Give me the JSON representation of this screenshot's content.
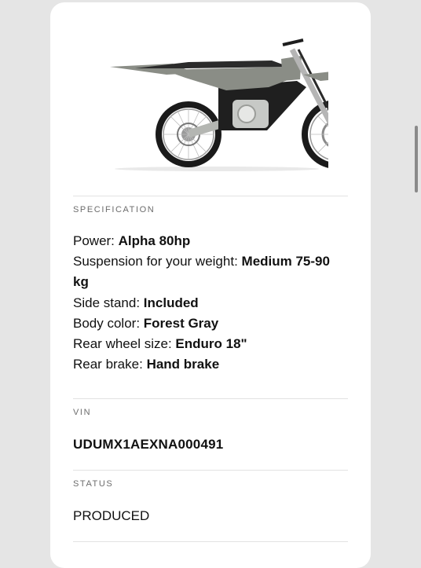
{
  "product": {
    "image_alt": "electric dirt bike",
    "colors": {
      "body": "#8a8d86",
      "seat": "#2b2b2b",
      "frame": "#1e1e1e",
      "tire": "#1a1a1a"
    }
  },
  "specification": {
    "label": "SPECIFICATION",
    "items": [
      {
        "name": "Power:",
        "value": "Alpha 80hp"
      },
      {
        "name": "Suspension for your weight:",
        "value": "Medium 75-90 kg"
      },
      {
        "name": "Side stand:",
        "value": "Included"
      },
      {
        "name": "Body color:",
        "value": "Forest Gray"
      },
      {
        "name": "Rear wheel size:",
        "value": "Enduro 18\""
      },
      {
        "name": "Rear brake:",
        "value": "Hand brake"
      }
    ]
  },
  "vin": {
    "label": "VIN",
    "value": "UDUMX1AEXNA000491"
  },
  "status": {
    "label": "STATUS",
    "value": "PRODUCED"
  }
}
